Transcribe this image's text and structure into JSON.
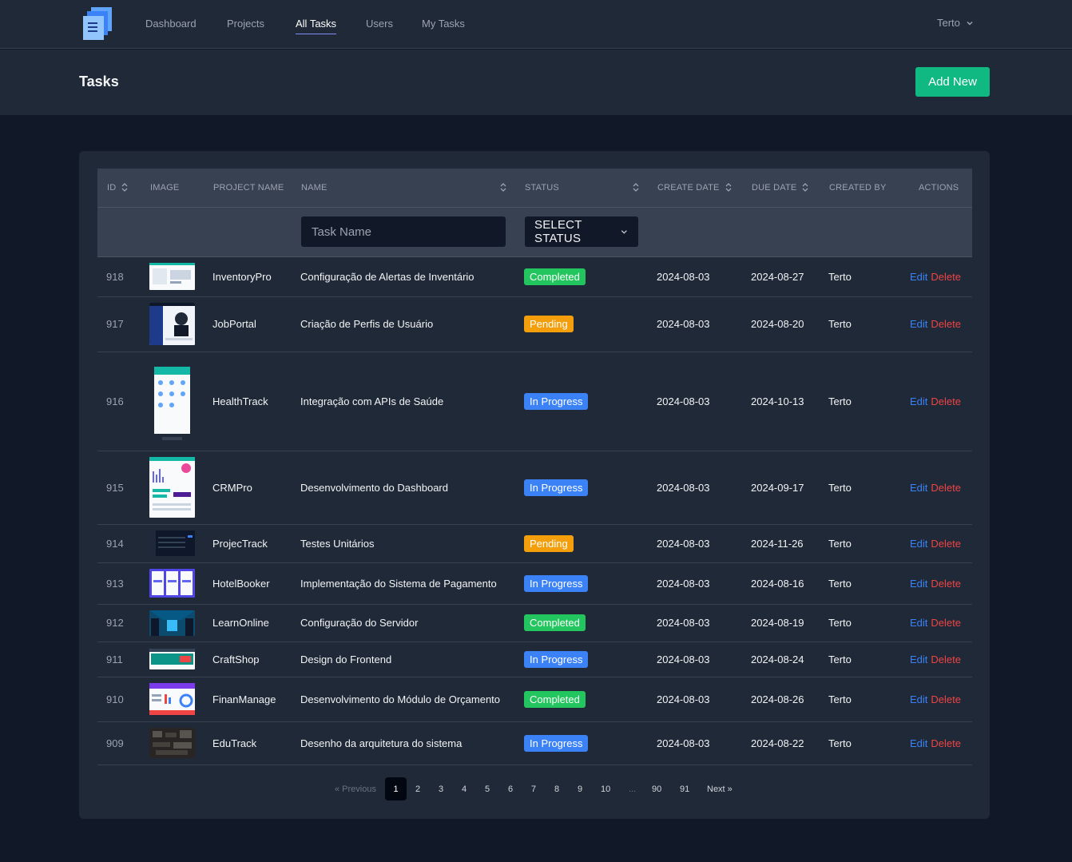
{
  "nav": {
    "links": [
      "Dashboard",
      "Projects",
      "All Tasks",
      "Users",
      "My Tasks"
    ],
    "active": "All Tasks",
    "user_name": "Terto"
  },
  "header": {
    "title": "Tasks",
    "add_button": "Add New"
  },
  "table": {
    "columns": [
      "ID",
      "IMAGE",
      "PROJECT NAME",
      "NAME",
      "STATUS",
      "CREATE DATE",
      "DUE DATE",
      "CREATED BY",
      "ACTIONS"
    ],
    "filters": {
      "task_name_placeholder": "Task Name",
      "status_select": "Select Status"
    },
    "action_labels": {
      "edit": "Edit",
      "delete": "Delete"
    },
    "rows": [
      {
        "id": "918",
        "project": "InventoryPro",
        "name": "Configuração de Alertas de Inventário",
        "status": "Completed",
        "create_date": "2024-08-03",
        "due_date": "2024-08-27",
        "created_by": "Terto"
      },
      {
        "id": "917",
        "project": "JobPortal",
        "name": "Criação de Perfis de Usuário",
        "status": "Pending",
        "create_date": "2024-08-03",
        "due_date": "2024-08-20",
        "created_by": "Terto"
      },
      {
        "id": "916",
        "project": "HealthTrack",
        "name": "Integração com APIs de Saúde",
        "status": "In Progress",
        "create_date": "2024-08-03",
        "due_date": "2024-10-13",
        "created_by": "Terto"
      },
      {
        "id": "915",
        "project": "CRMPro",
        "name": "Desenvolvimento do Dashboard",
        "status": "In Progress",
        "create_date": "2024-08-03",
        "due_date": "2024-09-17",
        "created_by": "Terto"
      },
      {
        "id": "914",
        "project": "ProjecTrack",
        "name": "Testes Unitários",
        "status": "Pending",
        "create_date": "2024-08-03",
        "due_date": "2024-11-26",
        "created_by": "Terto"
      },
      {
        "id": "913",
        "project": "HotelBooker",
        "name": "Implementação do Sistema de Pagamento",
        "status": "In Progress",
        "create_date": "2024-08-03",
        "due_date": "2024-08-16",
        "created_by": "Terto"
      },
      {
        "id": "912",
        "project": "LearnOnline",
        "name": "Configuração do Servidor",
        "status": "Completed",
        "create_date": "2024-08-03",
        "due_date": "2024-08-19",
        "created_by": "Terto"
      },
      {
        "id": "911",
        "project": "CraftShop",
        "name": "Design do Frontend",
        "status": "In Progress",
        "create_date": "2024-08-03",
        "due_date": "2024-08-24",
        "created_by": "Terto"
      },
      {
        "id": "910",
        "project": "FinanManage",
        "name": "Desenvolvimento do Módulo de Orçamento",
        "status": "Completed",
        "create_date": "2024-08-03",
        "due_date": "2024-08-26",
        "created_by": "Terto"
      },
      {
        "id": "909",
        "project": "EduTrack",
        "name": "Desenho da arquitetura do sistema",
        "status": "In Progress",
        "create_date": "2024-08-03",
        "due_date": "2024-08-22",
        "created_by": "Terto"
      }
    ]
  },
  "pagination": {
    "previous": "« Previous",
    "next": "Next »",
    "pages": [
      "1",
      "2",
      "3",
      "4",
      "5",
      "6",
      "7",
      "8",
      "9",
      "10",
      "...",
      "90",
      "91"
    ],
    "current": "1"
  },
  "colors": {
    "completed": "#22c55e",
    "pending": "#f59e0b",
    "in_progress": "#3b82f6",
    "add_button": "#10b981",
    "edit": "#3b82f6",
    "delete": "#ef4444"
  }
}
